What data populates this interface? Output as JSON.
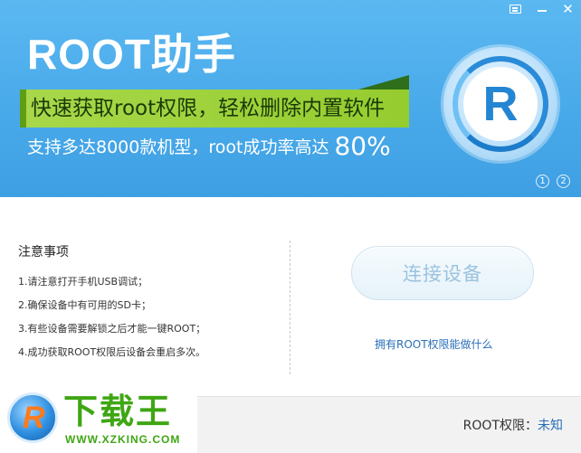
{
  "window": {
    "controls": [
      "skin-icon",
      "minimize-icon",
      "close-icon"
    ]
  },
  "banner": {
    "title": "ROOT助手",
    "slogan_line1": "快速获取root权限，轻松删除内置软件",
    "slogan_line2": "支持多达8000款机型，root成功率高达",
    "success_rate": "80%",
    "logo_letter": "R",
    "pager": [
      "1",
      "2"
    ],
    "colors": {
      "banner": "#4aa9ea",
      "slogan_band": "#9fd23d",
      "logo_ring": "#2a8bd8"
    }
  },
  "notes": {
    "title": "注意事项",
    "items": [
      "1.请注意打开手机USB调试；",
      "2.确保设备中有可用的SD卡；",
      "3.有些设备需要解锁之后才能一键ROOT；",
      "4.成功获取ROOT权限后设备会重启多次。"
    ]
  },
  "actions": {
    "connect_label": "连接设备",
    "root_link": "拥有ROOT权限能做什么"
  },
  "footer": {
    "root_label": "ROOT权限：",
    "root_value": "未知"
  },
  "watermark": {
    "name": "下载王",
    "url": "WWW.XZKING.COM"
  }
}
